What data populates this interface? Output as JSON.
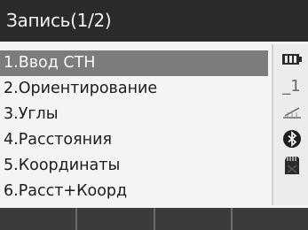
{
  "header": {
    "title": "Запись(1/2)"
  },
  "menu": {
    "items": [
      {
        "label": "1.Ввод  СТН",
        "selected": true
      },
      {
        "label": "2.Ориентирование",
        "selected": false
      },
      {
        "label": "3.Углы",
        "selected": false
      },
      {
        "label": "4.Расстояния",
        "selected": false
      },
      {
        "label": "5.Координаты",
        "selected": false
      },
      {
        "label": "6.Расст+Коорд",
        "selected": false
      }
    ]
  },
  "status": {
    "icons": [
      "battery-icon",
      "target-constant-icon",
      "tilt-compensation-icon",
      "bluetooth-icon",
      "sd-card-icon"
    ],
    "target_constant": "_1"
  },
  "softkeys": {
    "labels": [
      "",
      "",
      "",
      ""
    ]
  },
  "colors": {
    "title_bg": "#2a2a2a",
    "selection_bg": "#7c7c7c",
    "softkey_bg": "#3b3b3b"
  }
}
